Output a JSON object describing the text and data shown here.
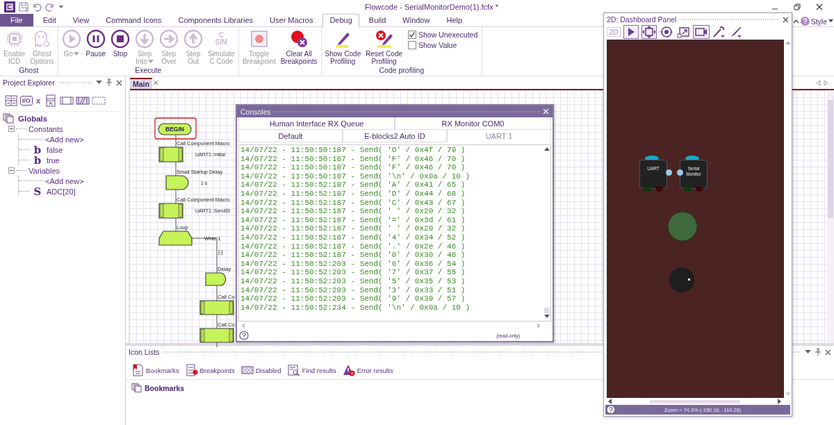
{
  "title_bar": {
    "title": "Flowcode - SerialMonitorDemo(1).fcfx *"
  },
  "menu_tabs": [
    {
      "label": "File",
      "kind": "file",
      "selected": false
    },
    {
      "label": "Edit",
      "kind": "tab",
      "selected": false
    },
    {
      "label": "View",
      "kind": "tab",
      "selected": false
    },
    {
      "label": "Command Icons",
      "kind": "tab",
      "selected": false
    },
    {
      "label": "Components Libraries",
      "kind": "tab",
      "selected": false
    },
    {
      "label": "User Macros",
      "kind": "tab",
      "selected": false
    },
    {
      "label": "Debug",
      "kind": "tab",
      "selected": true
    },
    {
      "label": "Build",
      "kind": "tab",
      "selected": false
    },
    {
      "label": "Window",
      "kind": "tab",
      "selected": false
    },
    {
      "label": "Help",
      "kind": "tab",
      "selected": false
    }
  ],
  "style_menu": {
    "label": "Style"
  },
  "ribbon": {
    "groups": [
      {
        "label": "Ghost",
        "buttons": [
          {
            "label": "Enable\nICD",
            "kind": "chip",
            "disabled": true
          },
          {
            "label": "Ghost\nOptions",
            "kind": "ghost",
            "disabled": true
          }
        ]
      },
      {
        "label": "Execute",
        "buttons": [
          {
            "label": "Go",
            "kind": "play",
            "disabled": true,
            "dropdown": true
          },
          {
            "label": "Pause",
            "kind": "pause",
            "disabled": false
          },
          {
            "label": "Stop",
            "kind": "stop",
            "disabled": false
          },
          {
            "label": "Step\nInto",
            "kind": "down",
            "disabled": true,
            "dropdown": true
          },
          {
            "label": "Step\nOver",
            "kind": "right",
            "disabled": true
          },
          {
            "label": "Step\nOut",
            "kind": "up",
            "disabled": true
          },
          {
            "label": "Simulate\nC Code",
            "kind": "csim",
            "glyph": "C\nSIM",
            "disabled": true
          }
        ]
      },
      {
        "buttons": [
          {
            "label": "Toggle\nBreakpoint",
            "kind": "breakpoint",
            "disabled": true
          },
          {
            "label": "Clear All\nBreakpoints",
            "kind": "clear",
            "disabled": false
          }
        ]
      },
      {
        "label": "Code profiling",
        "buttons": [
          {
            "label": "Show Code\nProfiling",
            "kind": "pen",
            "disabled": false
          },
          {
            "label": "Reset Code\nProfiling",
            "kind": "pen-x",
            "disabled": false
          }
        ],
        "checkboxes": [
          {
            "label": "Show Unexecuted",
            "checked": true
          },
          {
            "label": "Show Value",
            "checked": false
          }
        ]
      }
    ]
  },
  "project_explorer": {
    "title": "Project Explorer",
    "toolbar": [
      {
        "kind": "table"
      },
      {
        "kind": "io",
        "glyph": "I/O"
      },
      {
        "kind": "var",
        "glyph": "x"
      },
      {
        "kind": "macro"
      },
      {
        "kind": "block"
      },
      {
        "kind": "hatched"
      },
      {
        "kind": "dashed"
      }
    ],
    "tree": [
      {
        "label": "Globals",
        "children": [
          {
            "label": "Constants",
            "expanded": true,
            "children": [
              {
                "label": "<Add new>",
                "kind": "add"
              },
              {
                "label": "false",
                "kind": "value",
                "glyph": "b"
              },
              {
                "label": "true",
                "kind": "value",
                "glyph": "b"
              }
            ]
          },
          {
            "label": "Variables",
            "expanded": true,
            "children": [
              {
                "label": "<Add new>",
                "kind": "add"
              },
              {
                "label": "ADC[20]",
                "kind": "value",
                "glyph": "S"
              }
            ]
          }
        ]
      }
    ]
  },
  "editor": {
    "tabs": [
      {
        "label": "Main",
        "selected": true
      }
    ],
    "flowchart": {
      "nodes": [
        {
          "kind": "terminator",
          "label": "BEGIN",
          "selected": true
        },
        {
          "kind": "macro",
          "title": "Call Component Macro",
          "detail": "UART1::Initial"
        },
        {
          "kind": "delay",
          "title": "Small Startup Delay",
          "detail": "1 s"
        },
        {
          "kind": "macro",
          "title": "Call Component Macro",
          "detail": "UART1::SendSt"
        },
        {
          "kind": "loop",
          "title": "Loop",
          "detail": "While 1",
          "toggle": "[-]"
        },
        {
          "kind": "delay",
          "title": "Delay"
        },
        {
          "kind": "macro",
          "title": "Call Co"
        },
        {
          "kind": "macro",
          "title": "Call Co"
        }
      ]
    }
  },
  "consoles": {
    "title": "Consoles",
    "tab_rows": [
      [
        {
          "label": "Human Interface RX Queue",
          "selected": false
        },
        {
          "label": "RX Monitor COM0",
          "selected": false
        }
      ],
      [
        {
          "label": "Default",
          "selected": false
        },
        {
          "label": "E-blocks2 Auto ID",
          "selected": false
        },
        {
          "label": "UART 1",
          "selected": true
        }
      ]
    ],
    "lines": [
      "14/07/22 - 11:50:50:187 - Send( 'O' / 0x4f / 79 )",
      "14/07/22 - 11:50:50:187 - Send( 'F' / 0x46 / 70 )",
      "14/07/22 - 11:50:50:187 - Send( 'F' / 0x46 / 70 )",
      "14/07/22 - 11:50:50:187 - Send( '\\n' / 0x0a / 10 )",
      "14/07/22 - 11:50:52:187 - Send( 'A' / 0x41 / 65 )",
      "14/07/22 - 11:50:52:187 - Send( 'D' / 0x44 / 68 )",
      "14/07/22 - 11:50:52:187 - Send( 'C' / 0x43 / 67 )",
      "14/07/22 - 11:50:52:187 - Send( ' ' / 0x20 / 32 )",
      "14/07/22 - 11:50:52:187 - Send( '=' / 0x3d / 61 )",
      "14/07/22 - 11:50:52:187 - Send( ' ' / 0x20 / 32 )",
      "14/07/22 - 11:50:52:187 - Send( '4' / 0x34 / 52 )",
      "14/07/22 - 11:50:52:187 - Send( '.' / 0x2e / 46 )",
      "14/07/22 - 11:50:52:187 - Send( '0' / 0x30 / 48 )",
      "14/07/22 - 11:50:52:203 - Send( '6' / 0x36 / 54 )",
      "14/07/22 - 11:50:52:203 - Send( '7' / 0x37 / 55 )",
      "14/07/22 - 11:50:52:203 - Send( '5' / 0x35 / 53 )",
      "14/07/22 - 11:50:52:203 - Send( '3' / 0x33 / 51 )",
      "14/07/22 - 11:50:52:203 - Send( '9' / 0x39 / 57 )",
      "14/07/22 - 11:50:52:234 - Send( '\\n' / 0x0a / 10 )"
    ],
    "status": "(read-only)"
  },
  "icon_lists": {
    "title": "Icon Lists",
    "tabs": [
      {
        "label": "Bookmarks",
        "kind": "bookmark"
      },
      {
        "label": "Breakpoints",
        "kind": "breakpoint"
      },
      {
        "label": "Disabled",
        "kind": "disabled"
      },
      {
        "label": "Find results",
        "kind": "find"
      },
      {
        "label": "Error results",
        "kind": "error"
      }
    ],
    "list_title": "Bookmarks"
  },
  "dashboard": {
    "title": "2D: Dashboard Panel",
    "toolbar_badge": "2D",
    "components": [
      {
        "kind": "block",
        "label": "UART"
      },
      {
        "kind": "block",
        "label": "Serial Monitor"
      },
      {
        "kind": "led"
      },
      {
        "kind": "knob"
      }
    ],
    "status": "Zoom = 74.3% (-150.10, -110.28)"
  }
}
